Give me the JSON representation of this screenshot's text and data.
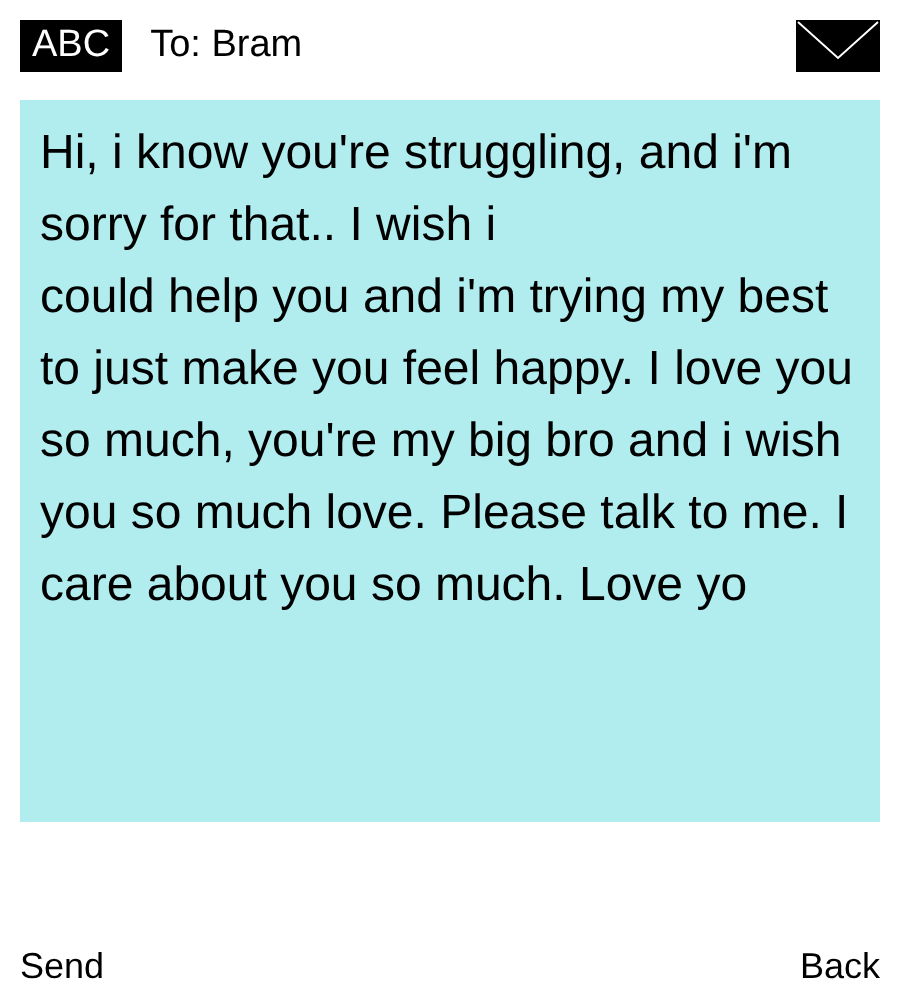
{
  "header": {
    "input_mode": "ABC",
    "recipient": "To: Bram"
  },
  "message": {
    "text": "Hi, i know you're struggling, and i'm sorry for that.. I wish i\ncould help you and i'm trying my best to just make you feel happy. I love you so much, you're my big bro and i wish you so much love. Please talk to me. I care about you so much. Love yo"
  },
  "softkeys": {
    "left": "Send",
    "right": "Back"
  }
}
